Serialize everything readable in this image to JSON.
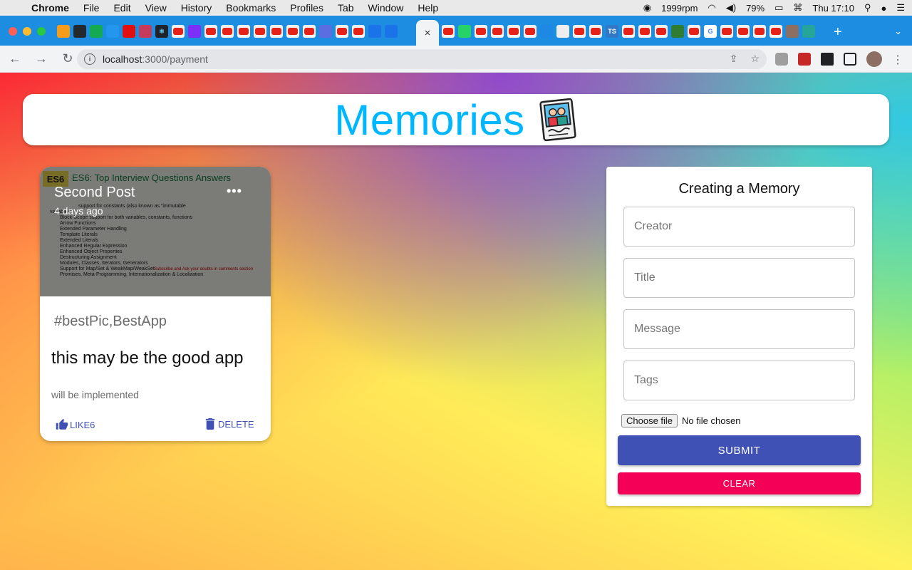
{
  "menubar": {
    "app_name": "Chrome",
    "items": [
      "File",
      "Edit",
      "View",
      "History",
      "Bookmarks",
      "Profiles",
      "Tab",
      "Window",
      "Help"
    ],
    "fan_speed": "1999rpm",
    "battery": "79%",
    "clock": "Thu 17:10"
  },
  "browser": {
    "url_host": "localhost",
    "url_path": ":3000/payment",
    "active_tab_close": "×",
    "new_tab": "+"
  },
  "app": {
    "title": "Memories"
  },
  "post": {
    "title": "Second Post",
    "date": "4 days ago",
    "more": "•••",
    "tags": "#bestPic,BestApp",
    "message_title": "this may be the good app",
    "message_body": "will be implemented",
    "like_label": "LIKE6",
    "delete_label": "DELETE",
    "image": {
      "badge": "ES6",
      "heading": "ES6: Top Interview Questions Answers",
      "lines": [
        "support for constants (also known as \"immutable",
        "variables\")",
        "Block-Scope support for both variables, constants, functions",
        "Arrow Functions",
        "Extended Parameter Handling",
        "Template Literals",
        "Extended Literals",
        "Enhanced Regular Expression",
        "Enhanced Object Properties",
        "Destructuring Assignment",
        "Modules, Classes, Iterators, Generators",
        "Support for Map/Set & WeakMap/WeakSet",
        "Promises, Meta-Programming, Internationalization & Localization"
      ],
      "note": "Subscribe and Ask your doubts in comments section"
    }
  },
  "form": {
    "heading": "Creating a Memory",
    "creator_placeholder": "Creator",
    "title_placeholder": "Title",
    "message_placeholder": "Message",
    "tags_placeholder": "Tags",
    "file_button": "Choose file",
    "file_status": "No file chosen",
    "submit_label": "SUBMIT",
    "clear_label": "CLEAR"
  },
  "colors": {
    "title": "#00b7ff",
    "primary": "#3f51b5",
    "secondary": "#f50057"
  }
}
